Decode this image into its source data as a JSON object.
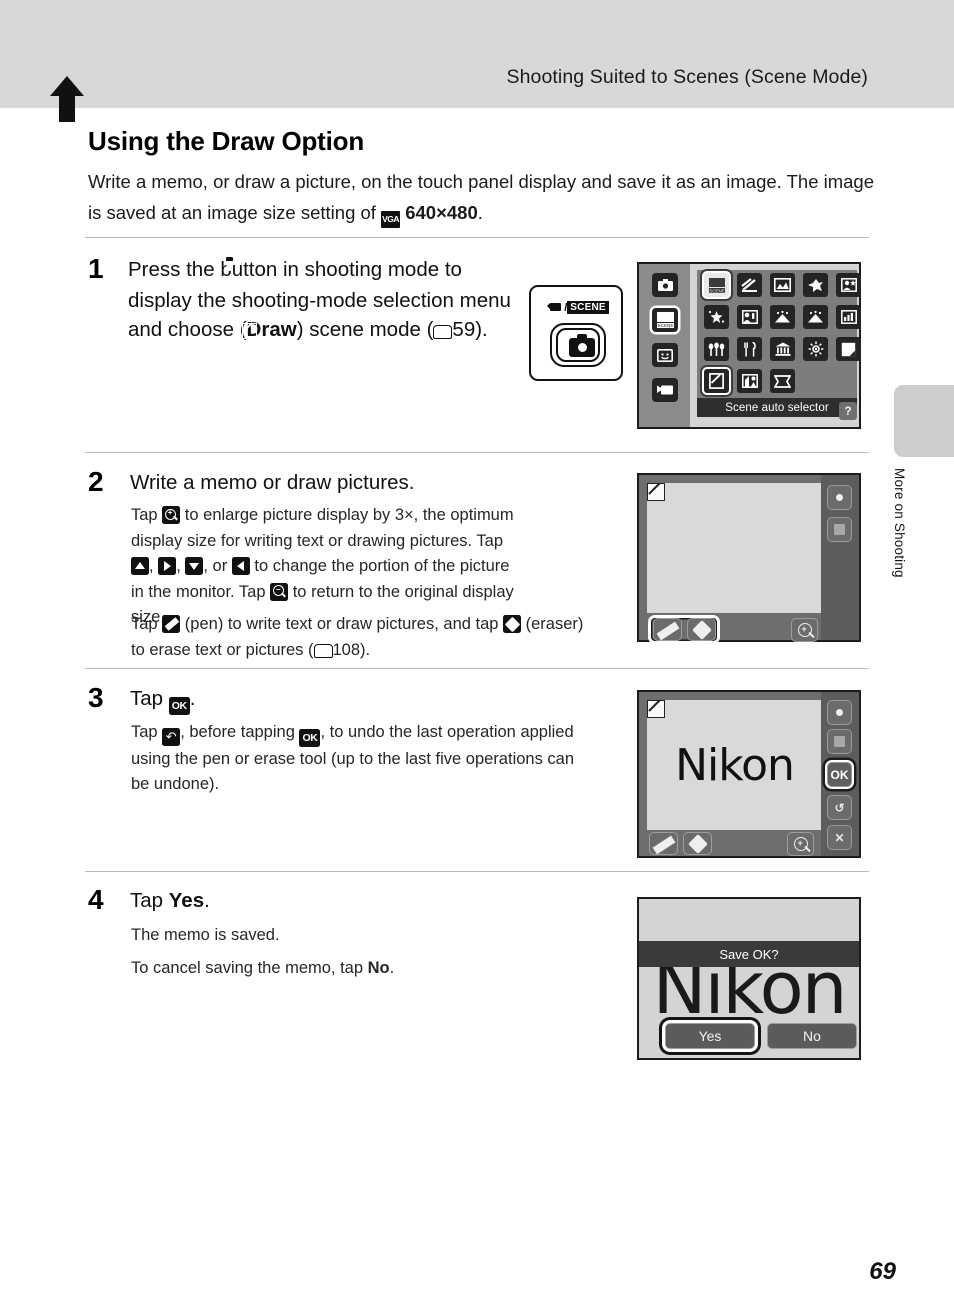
{
  "header": {
    "title": "Shooting Suited to Scenes (Scene Mode)"
  },
  "side_tab": {
    "label": "More on Shooting"
  },
  "page": {
    "number": "69"
  },
  "section": {
    "heading": "Using the Draw Option",
    "intro_1": "Write a memo, or draw a picture, on the touch panel display and save it as an",
    "intro_2a": "image. The image is saved at an image size setting of",
    "intro_vga_icon": "VGA",
    "intro_2b": "640×480",
    "intro_2c": "."
  },
  "steps": [
    {
      "number": "1",
      "head_a": "Press the",
      "head_icon": "camera-icon",
      "head_b": "button in shooting mode to display the shooting-mode selection menu and choose",
      "head_icon2": "draw-icon",
      "head_c": "(",
      "head_bold": "Draw",
      "head_d": ") scene mode (",
      "head_ref": "59",
      "head_e": ")."
    },
    {
      "number": "2",
      "head": "Write a memo or draw pictures.",
      "sub_1a": "Tap",
      "sub_1b": "to enlarge picture display by 3×, the optimum display size for writing text or drawing pictures. Tap",
      "sub_1c": ",",
      "sub_1d": ", or",
      "sub_1e": "to change the portion of the picture in the monitor. Tap",
      "sub_1f": "to return to the original display size.",
      "sub_2a": "Tap",
      "sub_2b": "(pen) to write text or draw pictures, and tap",
      "sub_2c": "(eraser) to erase text or pictures (",
      "sub_2d": "108",
      "sub_2e": ")."
    },
    {
      "number": "3",
      "head_a": "Tap",
      "head_b": ".",
      "sub_a": "Tap",
      "sub_b": ", before tapping",
      "sub_c": ", to undo the last operation applied using the pen or erase tool (up to the last five operations can be undone)."
    },
    {
      "number": "4",
      "head_a": "Tap",
      "head_bold": "Yes",
      "head_b": ".",
      "sub_1": "The memo is saved.",
      "sub_2a": "To cancel saving the memo, tap",
      "sub_2_bold": "No",
      "sub_2b": "."
    }
  ],
  "shot_scene_menu": {
    "caption": "Scene auto selector",
    "help_label": "?",
    "mode_icons": [
      "auto-mode-icon",
      "scene-mode-icon",
      "smart-portrait-icon",
      "movie-mode-icon"
    ],
    "scene_icons": [
      "scene-auto-selector-icon",
      "portrait-icon",
      "landscape-icon",
      "sports-icon",
      "night-portrait-icon",
      "party-indoor-icon",
      "beach-icon",
      "snow-icon",
      "sunset-icon",
      "dusk-dawn-icon",
      "close-up-icon",
      "food-icon",
      "museum-icon",
      "fireworks-icon",
      "copy-icon",
      "draw-icon",
      "backlight-icon",
      "panorama-icon"
    ],
    "selected_scene": "draw-icon",
    "highlighted_scene": "scene-auto-selector-icon"
  },
  "shot_draw_empty": {
    "badge": "draw-mode-badge",
    "buttons": [
      "record-dot-button",
      "stop-square-button"
    ],
    "tools": [
      "pen-tool",
      "eraser-tool"
    ],
    "zoom": "zoom-in-button"
  },
  "shot_draw_nikon": {
    "drawing_text": "Nikon",
    "badge": "draw-mode-badge",
    "buttons": [
      "record-dot-button",
      "stop-square-button",
      "ok-button",
      "undo-button",
      "cancel-button"
    ],
    "ok_label": "OK",
    "undo_label": "↺",
    "cancel_label": "✕",
    "tools": [
      "pen-tool",
      "eraser-tool"
    ],
    "zoom": "zoom-in-button"
  },
  "shot_confirm": {
    "drawing_text": "Nikon",
    "prompt": "Save OK?",
    "yes_label": "Yes",
    "no_label": "No",
    "selected": "Yes"
  }
}
